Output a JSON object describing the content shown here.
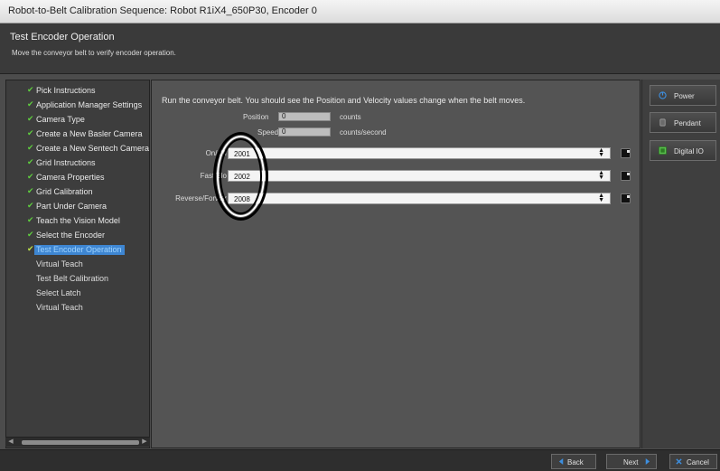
{
  "window": {
    "title": "Robot-to-Belt Calibration Sequence: Robot R1iX4_650P30, Encoder 0"
  },
  "header": {
    "title": "Test Encoder Operation",
    "description": "Move the conveyor belt to verify encoder operation."
  },
  "steps": [
    {
      "label": "Pick Instructions",
      "state": "done"
    },
    {
      "label": "Application Manager Settings",
      "state": "done"
    },
    {
      "label": "Camera Type",
      "state": "done"
    },
    {
      "label": "Create a New Basler Camera",
      "state": "done"
    },
    {
      "label": "Create a New Sentech Camera",
      "state": "done"
    },
    {
      "label": "Grid Instructions",
      "state": "done"
    },
    {
      "label": "Camera Properties",
      "state": "done"
    },
    {
      "label": "Grid Calibration",
      "state": "done"
    },
    {
      "label": "Part Under Camera",
      "state": "done"
    },
    {
      "label": "Teach the Vision Model",
      "state": "done"
    },
    {
      "label": "Select the Encoder",
      "state": "done"
    },
    {
      "label": "Test Encoder Operation",
      "state": "active"
    },
    {
      "label": "Virtual Teach",
      "state": "pending"
    },
    {
      "label": "Test Belt Calibration",
      "state": "pending"
    },
    {
      "label": "Select Latch",
      "state": "pending"
    },
    {
      "label": "Virtual Teach",
      "state": "pending"
    }
  ],
  "main": {
    "instruction": "Run the conveyor belt.  You should see the Position and Velocity values change when the belt moves.",
    "position": {
      "label": "Position",
      "value": "0",
      "unit": "counts"
    },
    "speed": {
      "label": "Speed",
      "value": "0",
      "unit": "counts/second"
    },
    "io_rows": [
      {
        "label": "On/Off",
        "value": "2001"
      },
      {
        "label": "Fast/Slo",
        "value": "2002"
      },
      {
        "label": "Reverse/Forwar",
        "value": "2008"
      }
    ]
  },
  "side_buttons": {
    "power": {
      "label": "Power",
      "icon": "power-icon"
    },
    "pendant": {
      "label": "Pendant",
      "icon": "pendant-icon"
    },
    "digital_io": {
      "label": "Digital IO",
      "icon": "digital-io-icon"
    }
  },
  "footer": {
    "back": "Back",
    "next": "Next",
    "cancel": "Cancel"
  },
  "colors": {
    "check": "#5fcf3f",
    "active_step": "#3e86d2",
    "io_icon": "#5bbf4f",
    "cancel_icon": "#3d8fe0"
  }
}
